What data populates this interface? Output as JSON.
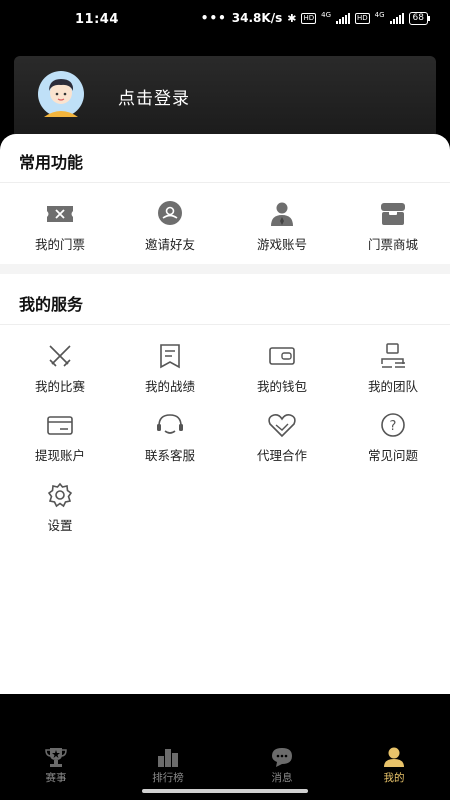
{
  "status_bar": {
    "time": "11:44",
    "dots": "•••",
    "network_speed": "34.8K/s",
    "hd1": "HD",
    "net1": "4G",
    "hd2": "HD",
    "net2": "4G",
    "battery": "68"
  },
  "profile": {
    "login_text": "点击登录"
  },
  "common_functions": {
    "title": "常用功能",
    "items": [
      {
        "label": "我的门票",
        "icon": "ticket-icon"
      },
      {
        "label": "邀请好友",
        "icon": "invite-friend-icon"
      },
      {
        "label": "游戏账号",
        "icon": "game-account-icon"
      },
      {
        "label": "门票商城",
        "icon": "ticket-shop-icon"
      }
    ]
  },
  "my_services": {
    "title": "我的服务",
    "items": [
      {
        "label": "我的比赛",
        "icon": "crossed-swords-icon"
      },
      {
        "label": "我的战绩",
        "icon": "record-bookmark-icon"
      },
      {
        "label": "我的钱包",
        "icon": "wallet-icon"
      },
      {
        "label": "我的团队",
        "icon": "team-icon"
      },
      {
        "label": "提现账户",
        "icon": "card-icon"
      },
      {
        "label": "联系客服",
        "icon": "headset-icon"
      },
      {
        "label": "代理合作",
        "icon": "handshake-heart-icon"
      },
      {
        "label": "常见问题",
        "icon": "question-icon"
      },
      {
        "label": "设置",
        "icon": "gear-icon"
      }
    ]
  },
  "bottom_nav": {
    "items": [
      {
        "label": "赛事",
        "icon": "trophy-icon",
        "active": false
      },
      {
        "label": "排行榜",
        "icon": "leaderboard-icon",
        "active": false
      },
      {
        "label": "消息",
        "icon": "message-icon",
        "active": false
      },
      {
        "label": "我的",
        "icon": "profile-icon",
        "active": true
      }
    ],
    "active_color": "#e8c36a",
    "inactive_color": "#8a8a8a"
  }
}
